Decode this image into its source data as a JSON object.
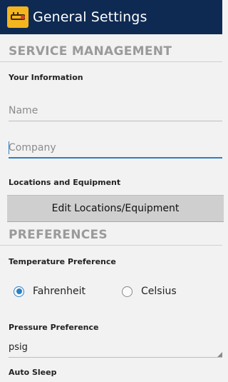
{
  "app_bar": {
    "title": "General Settings",
    "icon": "thermometer-app-icon",
    "background": "#0e2a52"
  },
  "service_management": {
    "header": "SERVICE MANAGEMENT",
    "your_information_label": "Your Information",
    "name_placeholder": "Name",
    "company_placeholder": "Company",
    "locations_label": "Locations and Equipment",
    "edit_button_label": "Edit Locations/Equipment"
  },
  "preferences": {
    "header": "PREFERENCES",
    "temperature_label": "Temperature Preference",
    "temperature_options": [
      "Fahrenheit",
      "Celsius"
    ],
    "temperature_selected": "Fahrenheit",
    "pressure_label": "Pressure Preference",
    "pressure_value": "psig",
    "auto_sleep_label": "Auto Sleep"
  },
  "colors": {
    "accent": "#2c7fc6",
    "section_header": "#9a9a9a",
    "app_icon": "#f4b51f"
  }
}
